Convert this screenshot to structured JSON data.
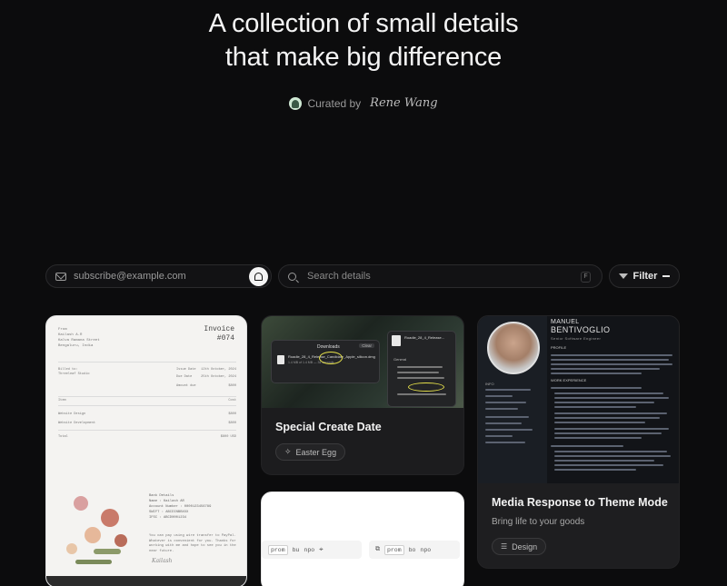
{
  "hero": {
    "title_line1": "A collection of small details",
    "title_line2": "that make big difference",
    "curated_label": "Curated by",
    "curator_signature": "Rene Wang"
  },
  "toolbar": {
    "subscribe_placeholder": "subscribe@example.com",
    "search_placeholder": "Search details",
    "search_shortcut": "F",
    "filter_label": "Filter"
  },
  "cards": {
    "invoice": {
      "title": "Invoice",
      "number": "#074",
      "from_lines": [
        "From",
        "Kailash A.R",
        "Kalva Ramana Street",
        "Bengaluru, India"
      ],
      "billed_to": "Billed to:",
      "billed_name": "Threeleaf Studio",
      "issue_label": "Issue Date",
      "issue_value": "12th October, 2024",
      "due_label": "Due Date",
      "due_value": "25th October, 2024",
      "amount_label": "Amount due",
      "amount_value": "$800",
      "item_header": "Item",
      "cost_header": "Cost",
      "items": [
        {
          "name": "Website Design",
          "cost": "$800"
        },
        {
          "name": "Website Development",
          "cost": "$800"
        }
      ],
      "total_label": "Total",
      "total_value": "$800 USD",
      "bank_title": "Bank Details",
      "bank_rows": [
        {
          "label": "Name",
          "value": ": Kailash AR"
        },
        {
          "label": "Account Number",
          "value": ": 0000123456789"
        },
        {
          "label": "SWIFT",
          "value": ": ABCDINBBXXX"
        },
        {
          "label": "IFSC",
          "value": ": ABCD0001234"
        }
      ],
      "note": "You can pay using wire transfer to PayPal. Whatever is convenient for you. Thanks for working with me and hope to see you in the near future.",
      "signature": "Kailash"
    },
    "special": {
      "title": "Special Create Date",
      "tag_label": "Easter Egg",
      "window_title": "Downloads",
      "window_action": "Clear",
      "file_name": "Roadie_28_4_Release_Candidate_Apple_silicon.dmg",
      "file_meta": "1.4 MB of 1.4 MB — 34 seconds",
      "finder_title": "Roadie_28_4_Release...",
      "finder_general": "General"
    },
    "media": {
      "title": "Media Response to Theme Mode",
      "subtitle": "Bring life to your goods",
      "tag_label": "Design",
      "resume_first": "MANUEL",
      "resume_last": "BENTIVOGLIO",
      "resume_role": "Senior Software Engineer",
      "resume_profile": "PROFILE",
      "resume_info": "INFO",
      "resume_exp": "WORK EXPERIENCE"
    },
    "keys": {
      "strip1": [
        "prom",
        "bu",
        "npo"
      ],
      "strip2": [
        "prom",
        "bo",
        "npo"
      ]
    }
  },
  "colors": {
    "background": "#0c0c0d",
    "card_dark": "#1c1c1e",
    "text_primary": "#f4f4f4",
    "text_muted": "#9a9a9a"
  },
  "icons": [
    "mail-icon",
    "bell-icon",
    "search-icon",
    "filter-icon",
    "minus-icon",
    "sparkle-icon",
    "layers-icon"
  ]
}
